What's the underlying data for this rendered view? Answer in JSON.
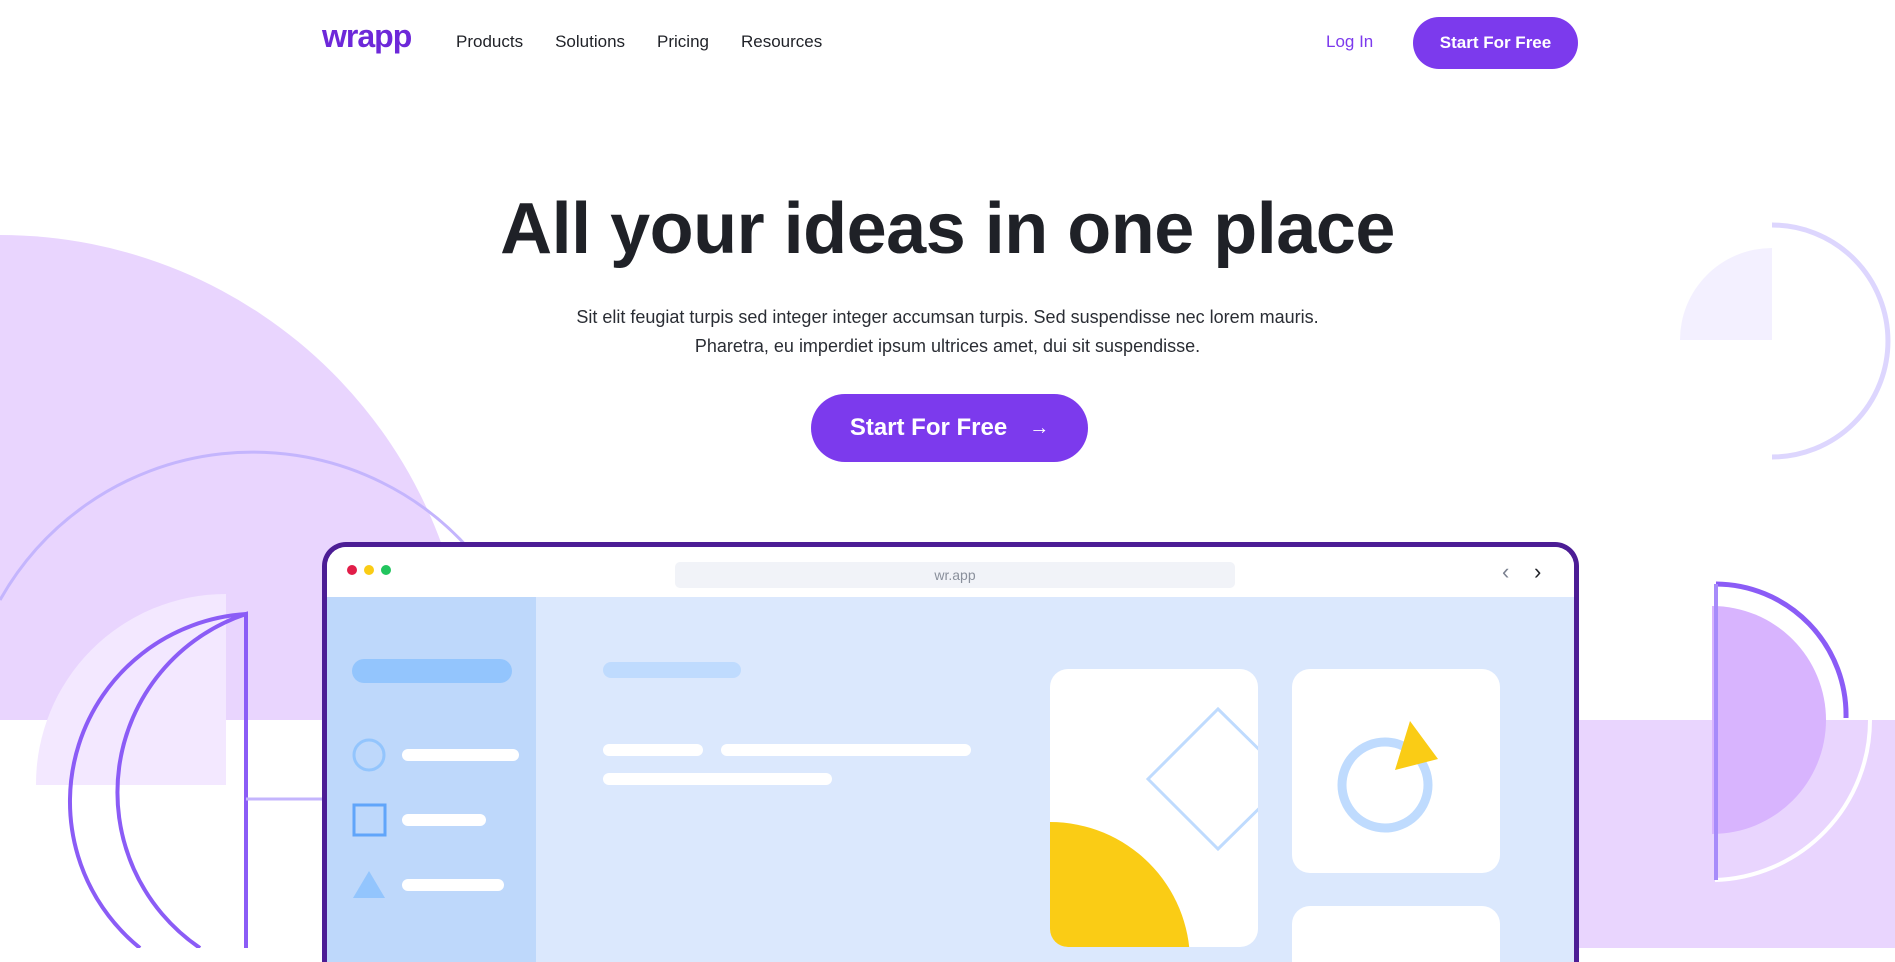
{
  "nav": {
    "logo": "wrapp",
    "links": [
      "Products",
      "Solutions",
      "Pricing",
      "Resources"
    ],
    "login_label": "Log In",
    "cta_label": "Start For Free"
  },
  "hero": {
    "title": "All your ideas in one place",
    "subtitle_line1": "Sit elit feugiat turpis sed integer integer accumsan turpis. Sed suspendisse nec lorem mauris.",
    "subtitle_line2": "Pharetra, eu imperdiet ipsum ultrices amet, dui sit suspendisse.",
    "cta_label": "Start For Free",
    "cta_icon": "arrow-right-icon"
  },
  "browser": {
    "url": "wr.app",
    "dots": [
      "#e11d48",
      "#facc15",
      "#22c55e"
    ],
    "back_icon": "chevron-left-icon",
    "forward_icon": "chevron-right-icon"
  },
  "colors": {
    "brand": "#7c3aed",
    "brand_dark": "#4c1d95",
    "lavender": "#e9d5ff",
    "app_bg": "#dbe8fd",
    "sidebar_bg": "#bed8fb",
    "accent_yellow": "#facc15"
  }
}
